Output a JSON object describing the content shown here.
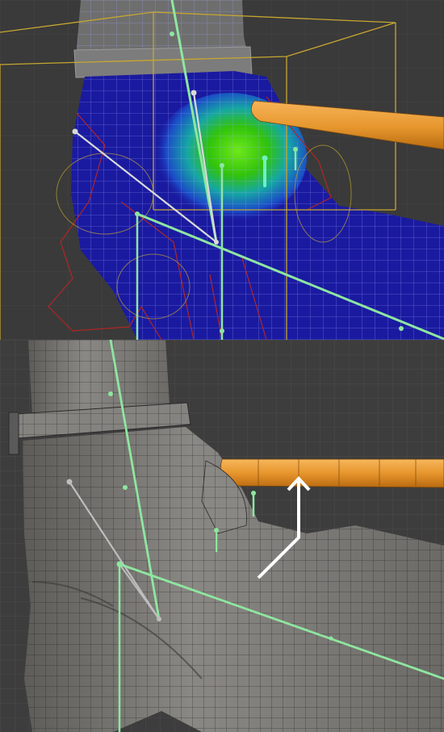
{
  "panels": [
    {
      "id": "weight-paint-view",
      "description_visible": "",
      "colors": {
        "background": "#3a3a3a",
        "mesh_base": "#1a1aa0",
        "weight_high": "#39d10f",
        "weight_mid": "#19b6a0",
        "bone": "#8ee6a0",
        "bone_selected": "#d9d9d9",
        "bounding_box": "#c7a730",
        "rig_outline": "#b02626",
        "handle": "#e39a2d"
      }
    },
    {
      "id": "solid-shaded-view",
      "colors": {
        "background": "#3d3d3d",
        "mesh_base": "#7d7b77",
        "bone": "#8ee6a0",
        "bone_selected": "#bdbdbd",
        "handle": "#e89b2f",
        "arrow": "#ffffff"
      }
    }
  ]
}
